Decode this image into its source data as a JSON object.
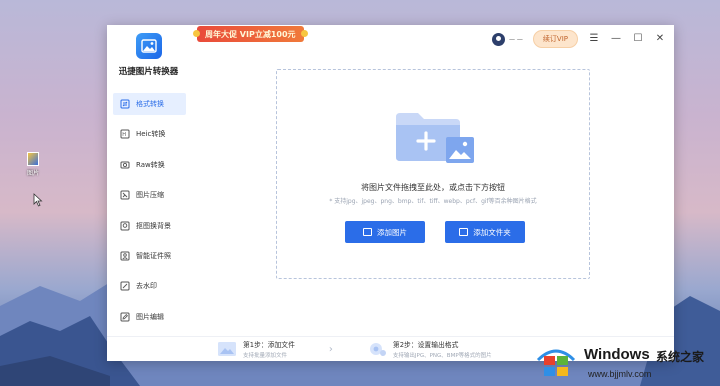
{
  "desktop": {
    "icon_label": "图片"
  },
  "window": {
    "promo_text": "周年大促 VIP立减100元",
    "user_name": "— —",
    "vip_button": "续订VIP",
    "controls": {
      "menu": "☰",
      "minimize": "—",
      "maximize": "☐",
      "close": "✕"
    }
  },
  "sidebar": {
    "app_name": "迅捷图片转换器",
    "items": [
      {
        "label": "格式转换",
        "icon": "convert-icon",
        "active": true
      },
      {
        "label": "Heic转换",
        "icon": "heic-icon",
        "active": false
      },
      {
        "label": "Raw转换",
        "icon": "raw-icon",
        "active": false
      },
      {
        "label": "图片压缩",
        "icon": "compress-icon",
        "active": false
      },
      {
        "label": "抠图换背景",
        "icon": "cutout-icon",
        "active": false
      },
      {
        "label": "智能证件照",
        "icon": "id-photo-icon",
        "active": false
      },
      {
        "label": "去水印",
        "icon": "watermark-icon",
        "active": false
      },
      {
        "label": "图片编辑",
        "icon": "edit-icon",
        "active": false
      }
    ]
  },
  "dropzone": {
    "title": "将图片文件拖拽至此处，或点击下方按钮",
    "subtitle": "* 支持jpg、jpeg、png、bmp、tif、tiff、webp、pcf、gif等百余种图片格式",
    "add_image": "添加图片",
    "add_folder": "添加文件夹"
  },
  "steps": [
    {
      "title": "第1步：添加文件",
      "sub": "支持批量添加文件"
    },
    {
      "title": "第2步：设置输出格式",
      "sub": "支持输出JPG、PNG、BMP等格式的图片"
    }
  ],
  "watermark": {
    "brand": "Windows",
    "cn": "系统之家",
    "url": "www.bjjmlv.com"
  },
  "colors": {
    "accent": "#2b6de8",
    "promo": "#e94a3a",
    "vip_bg": "#fde5cc"
  }
}
